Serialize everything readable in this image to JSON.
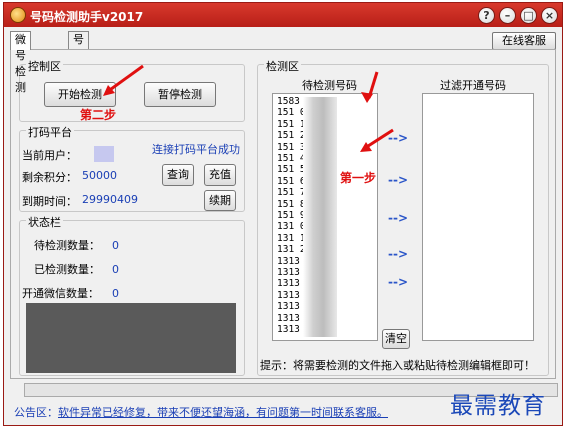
{
  "window": {
    "title": "号码检测助手v2017"
  },
  "tabs": [
    {
      "label": "微号检测"
    },
    {
      "label": "号码生成"
    }
  ],
  "online_service_label": "在线客服",
  "control": {
    "title": "控制区",
    "start_label": "开始检测",
    "pause_label": "暂停检测",
    "step2_annotation": "第二步"
  },
  "platform": {
    "title": "打码平台",
    "current_user_label": "当前用户：",
    "connected_text": "连接打码平台成功",
    "points_label": "剩余积分：",
    "points_value": "50000",
    "expire_label": "到期时间：",
    "expire_value": "29990409",
    "query_label": "查询",
    "recharge_label": "充值",
    "renew_label": "续期"
  },
  "status": {
    "title": "状态栏",
    "pending_label": "待检测数量：",
    "pending_value": "0",
    "checked_label": "已检测数量：",
    "checked_value": "0",
    "opened_label": "开通微信数量：",
    "opened_value": "0"
  },
  "detect": {
    "title": "检测区",
    "pending_header": "待检测号码",
    "filtered_header": "过滤开通号码",
    "step1_annotation": "第一步",
    "numbers": [
      "1583    9999",
      "151     0000",
      "151     1111",
      "151     2222",
      "151     3333",
      "151     4444",
      "151     5555",
      "151     6666",
      "151     7777",
      "151     8888",
      "151     9999",
      "131     0000",
      "131     1111",
      "131     2222",
      "1313    3333",
      "1313    4444",
      "1313    5555",
      "1313    6666",
      "1313    7777",
      "1313    8888",
      "1313    9999"
    ],
    "arrow_glyph": "-->",
    "clear_label": "清空",
    "tip": "提示：将需要检测的文件拖入或粘贴待检测编辑框即可！"
  },
  "notice": {
    "label": "公告区：",
    "body": "软件异常已经修复，带来不便还望海涵，有问题第一时间联系客服。"
  },
  "watermark": "最需教育"
}
